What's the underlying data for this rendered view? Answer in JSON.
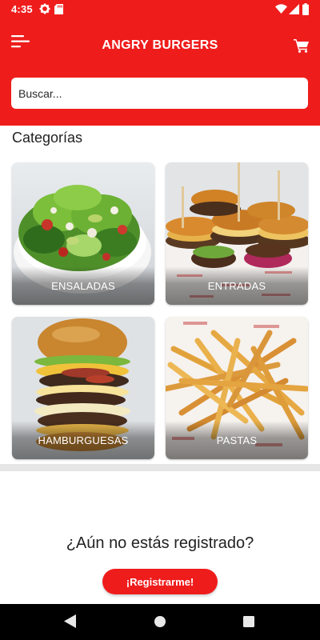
{
  "status_bar": {
    "time": "4:35",
    "icons": [
      "gear-icon",
      "sd-card-icon",
      "wifi-icon",
      "signal-icon",
      "battery-icon"
    ]
  },
  "app_bar": {
    "title": "ANGRY BURGERS",
    "menu_icon": "menu-icon",
    "cart_icon": "cart-icon",
    "background_color": "#ef1c1c"
  },
  "search": {
    "placeholder": "Buscar...",
    "value": ""
  },
  "categories": {
    "title": "Categorías",
    "items": [
      {
        "label": "ENSALADAS"
      },
      {
        "label": "ENTRADAS"
      },
      {
        "label": "HAMBURGUESAS"
      },
      {
        "label": "PASTAS"
      }
    ]
  },
  "register": {
    "question": "¿Aún no estás registrado?",
    "button_label": "¡Registrarme!",
    "button_color": "#ef1c1c"
  },
  "nav_bar": {
    "icons": [
      "back-icon",
      "home-icon",
      "recent-apps-icon"
    ]
  }
}
